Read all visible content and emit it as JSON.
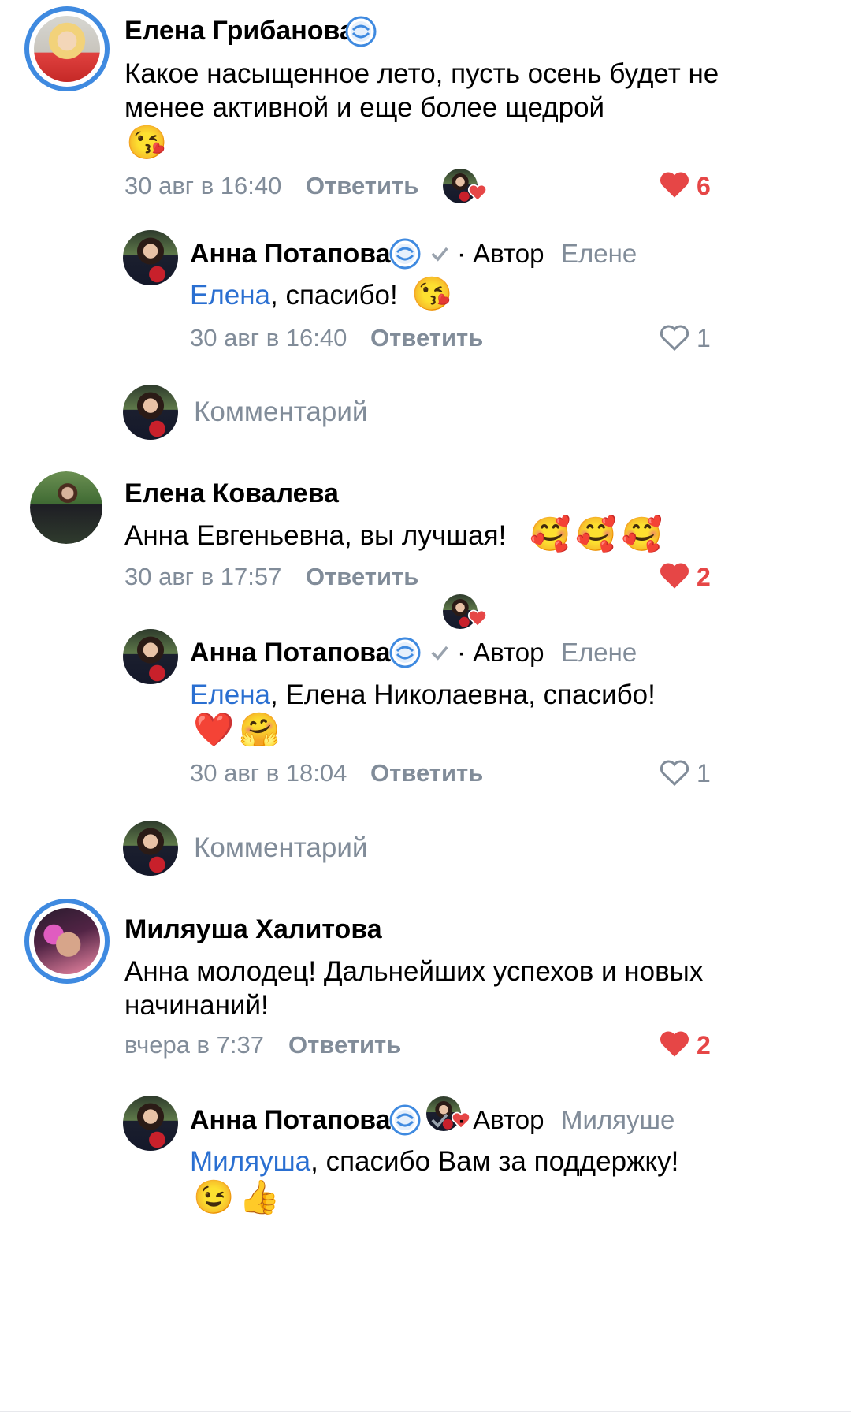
{
  "colors": {
    "accent": "#3f8ae0",
    "like_red": "#e64646",
    "meta_gray": "#818c99",
    "mention_blue": "#2a6fd1"
  },
  "comments": [
    {
      "author": "Елена Грибанова",
      "verified": true,
      "text": "Какое насыщенное лето, пусть осень будет не менее активной и еще более щедрой",
      "emoji": "😘",
      "time": "30 авг в 16:40",
      "reply_label": "Ответить",
      "likes": "6",
      "reply": {
        "author": "Анна Потапова",
        "author_tag": "· Автор",
        "to": "Елене",
        "mention": "Елена",
        "text": ", спасибо!",
        "emoji": "😘",
        "time": "30 авг в 16:40",
        "reply_label": "Ответить",
        "likes": "1"
      },
      "comment_placeholder": "Комментарий"
    },
    {
      "author": "Елена Ковалева",
      "verified": false,
      "text": "Анна Евгеньевна, вы лучшая!",
      "emoji": "🥰🥰🥰",
      "time": "30 авг в 17:57",
      "reply_label": "Ответить",
      "likes": "2",
      "reply": {
        "author": "Анна Потапова",
        "author_tag": "· Автор",
        "to": "Елене",
        "mention": "Елена",
        "text": ", Елена Николаевна, спасибо!",
        "emoji": "❤️🤗",
        "time": "30 авг в 18:04",
        "reply_label": "Ответить",
        "likes": "1"
      },
      "comment_placeholder": "Комментарий"
    },
    {
      "author": "Миляуша Халитова",
      "verified": false,
      "text": "Анна молодец! Дальнейших успехов и новых начинаний!",
      "time": "вчера в 7:37",
      "reply_label": "Ответить",
      "likes": "2",
      "reply": {
        "author": "Анна Потапова",
        "author_tag": "· Автор",
        "to": "Миляуше",
        "mention": "Миляуша",
        "text": ", спасибо Вам за поддержку!",
        "emoji": "😉👍"
      }
    }
  ]
}
